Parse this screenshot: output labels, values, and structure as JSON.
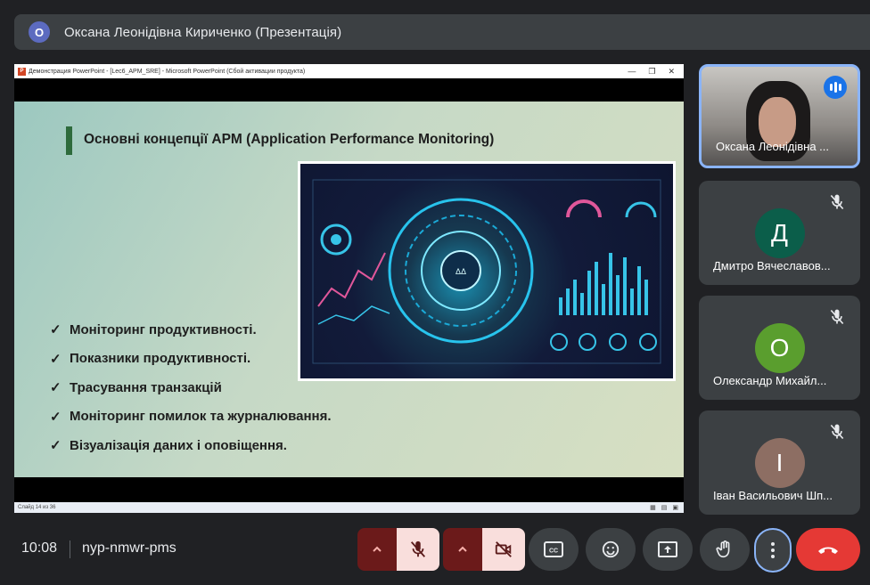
{
  "header": {
    "badge": "О",
    "title": "Оксана Леонідівна Кириченко (Презентація)"
  },
  "presentation": {
    "window_title": "Демонстрация PowerPoint - [Lec6_APM_SRE] - Microsoft PowerPoint (Сбой активации продукта)",
    "window_controls": [
      "—",
      "❐",
      "✕"
    ],
    "slide_title": "Основні концепції APM (Application Performance Monitoring)",
    "bullets": [
      "Моніторинг продуктивності.",
      "Показники продуктивності.",
      "Трасування транзакцій",
      "Моніторинг помилок та журналювання.",
      "Візуалізація даних і оповіщення."
    ],
    "check_glyph": "✓",
    "status_left": "Слайд 14 из 36",
    "status_right_icons": [
      "slide-sorter-icon",
      "normal-view-icon",
      "reading-view-icon"
    ]
  },
  "participants": [
    {
      "name": "Оксана Леонідівна ...",
      "speaking": true
    },
    {
      "name": "Дмитро Вячеславов...",
      "initial": "Д",
      "color": "#0b5e4a",
      "muted": true
    },
    {
      "name": "Олександр Михайл...",
      "initial": "О",
      "color": "#5a9e2e",
      "muted": true
    },
    {
      "name": "Іван Васильович Шп...",
      "initial": "І",
      "color": "#8d6e63",
      "muted": true
    }
  ],
  "footer": {
    "time": "10:08",
    "meeting_code": "nyp-nmwr-pms"
  },
  "colors": {
    "accent": "#8ab4f8",
    "danger": "#e53935",
    "muted_bg": "#f9dedc"
  }
}
